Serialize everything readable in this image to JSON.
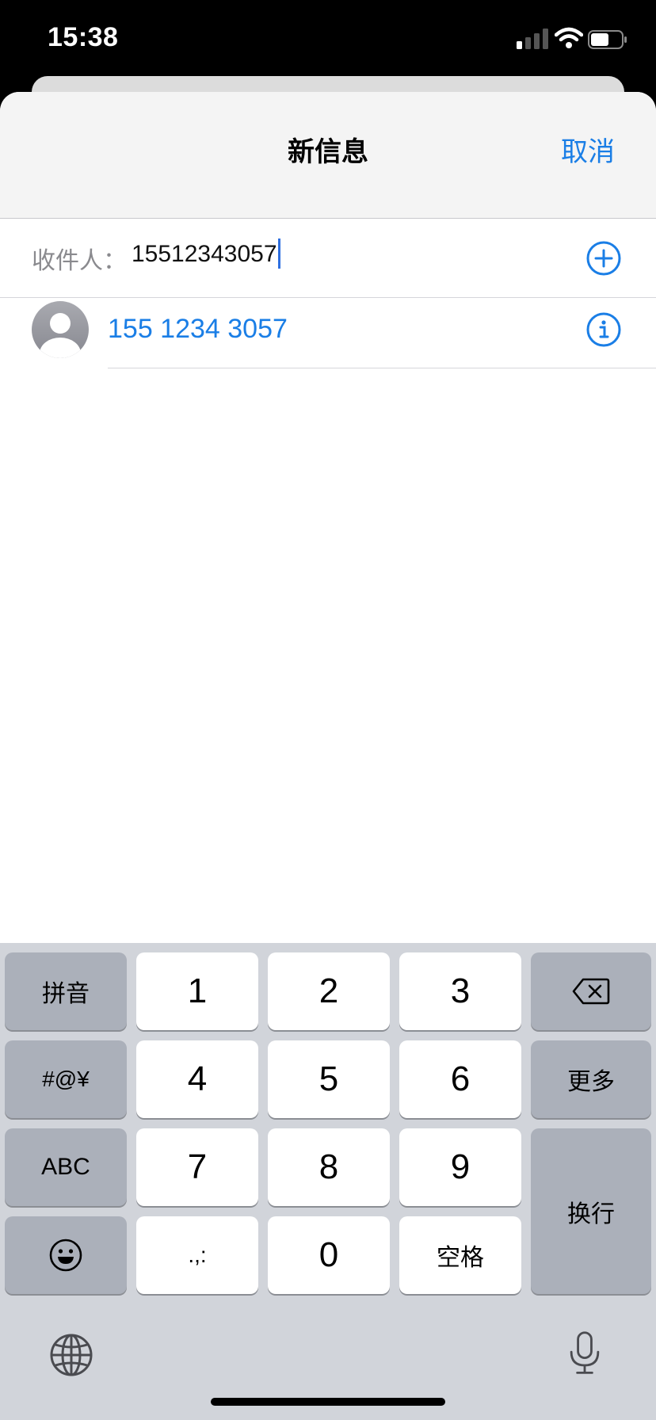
{
  "status_bar": {
    "time": "15:38"
  },
  "nav": {
    "title": "新信息",
    "cancel_label": "取消"
  },
  "recipient": {
    "label": "收件人：",
    "value": "15512343057"
  },
  "suggestion": {
    "number": "155 1234 3057"
  },
  "keyboard": {
    "keys": {
      "pinyin": "拼音",
      "k1": "1",
      "k2": "2",
      "k3": "3",
      "symbols": "#@¥",
      "k4": "4",
      "k5": "5",
      "k6": "6",
      "more": "更多",
      "abc": "ABC",
      "k7": "7",
      "k8": "8",
      "k9": "9",
      "return": "换行",
      "punct": ".,:",
      "k0": "0",
      "space": "空格"
    }
  },
  "colors": {
    "accent": "#1a7ee6",
    "keyboard_bg": "#d1d4da",
    "key_gray": "#abb0ba"
  }
}
